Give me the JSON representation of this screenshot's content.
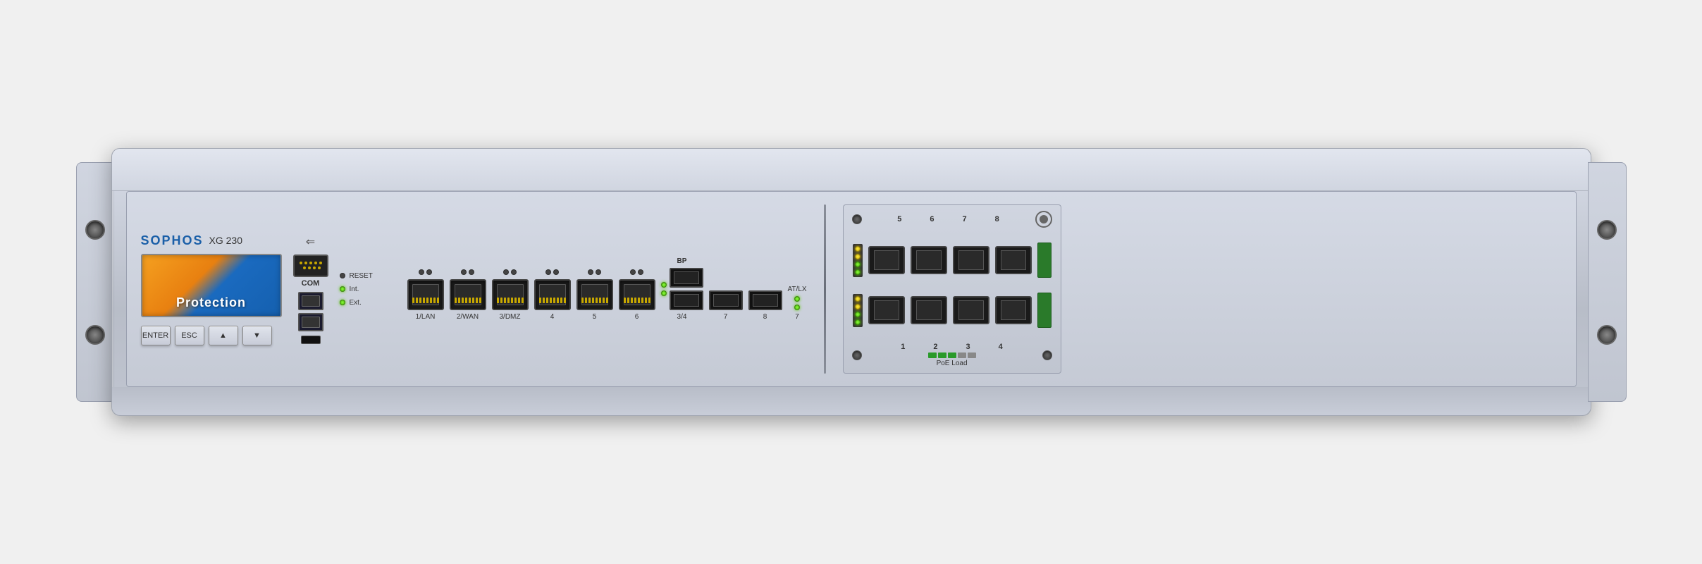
{
  "device": {
    "brand": "SOPHOS",
    "model": "XG 230",
    "lcd_text": "Protection",
    "colors": {
      "brand_blue": "#1a5fa8",
      "led_green": "#3da800",
      "led_yellow": "#c8a800",
      "orange": "#e88010",
      "blue": "#1560af"
    }
  },
  "buttons": {
    "enter": "ENTER",
    "esc": "ESC",
    "up": "▲",
    "down": "▼"
  },
  "labels": {
    "com": "COM",
    "reset": "RESET",
    "int": "Int.",
    "ext": "Ext.",
    "usb_symbol": "←",
    "port_1lan": "1/LAN",
    "port_2wan": "2/WAN",
    "port_3dmz": "3/DMZ",
    "port_4": "4",
    "port_5": "5",
    "port_6": "6",
    "port_bp": "BP",
    "port_bp_sub": "3/4",
    "port_7": "7",
    "port_8": "8",
    "at_lx": "AT/LX",
    "at_num": "7",
    "poe_load": "PoE Load",
    "exp_port_5": "5",
    "exp_port_6": "6",
    "exp_port_7": "7",
    "exp_port_8": "8",
    "exp_port_1": "1",
    "exp_port_2": "2",
    "exp_port_3": "3",
    "exp_port_4": "4"
  }
}
